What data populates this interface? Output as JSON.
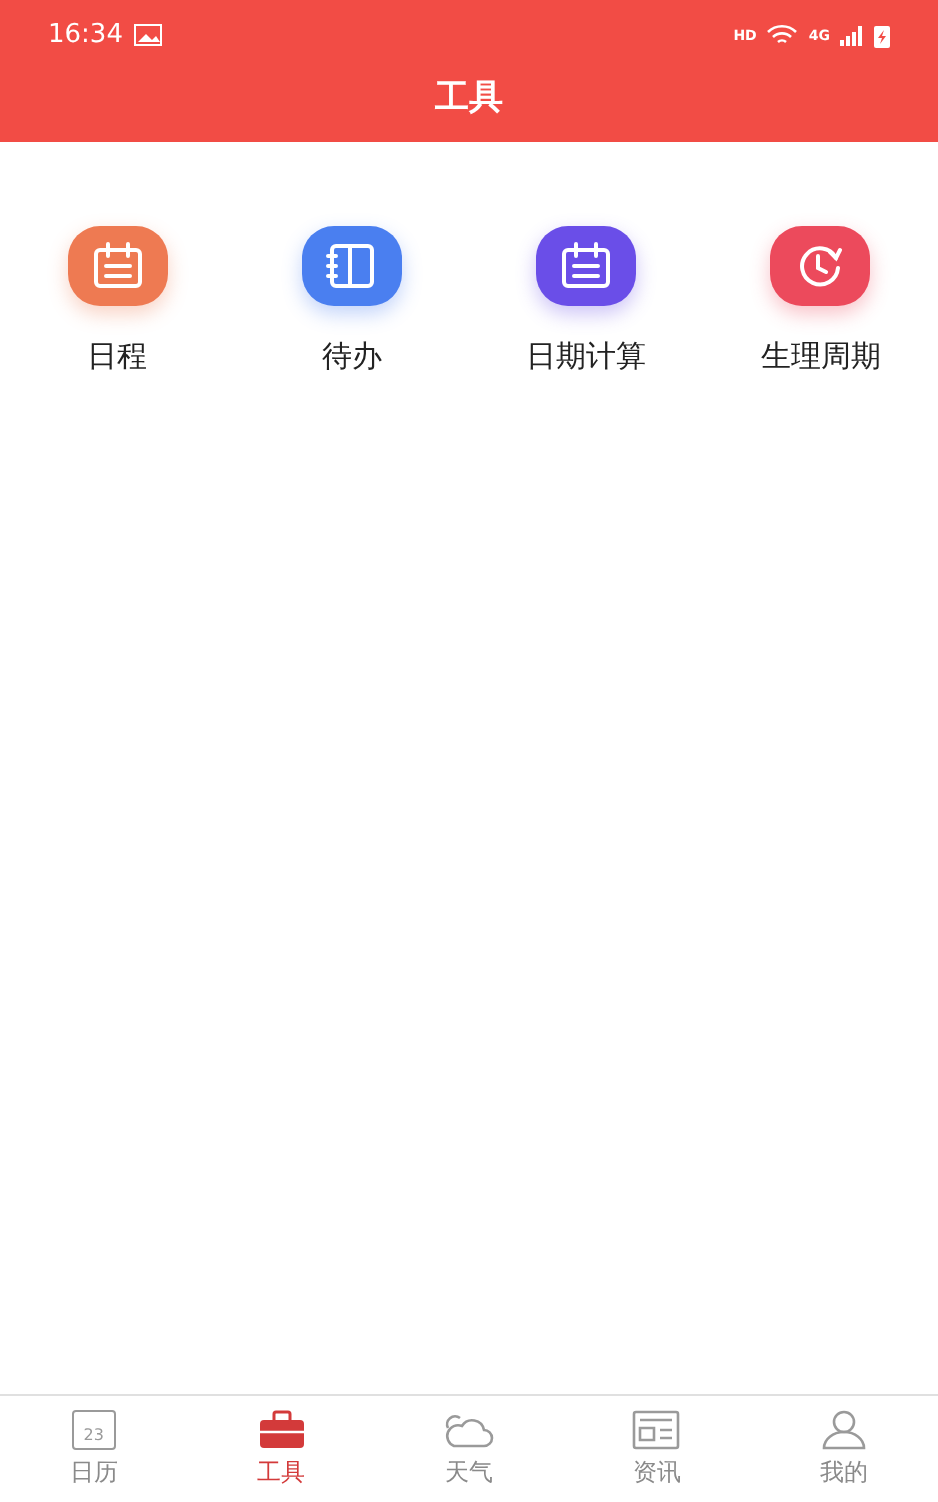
{
  "status_bar": {
    "time": "16:34",
    "network_label": "HD",
    "cell_label": "4G"
  },
  "header": {
    "title": "工具"
  },
  "tools": [
    {
      "label": "日程",
      "kind": "calendar",
      "color": "#ee7a52"
    },
    {
      "label": "待办",
      "kind": "notebook",
      "color": "#4a7ff0"
    },
    {
      "label": "日期计算",
      "kind": "calendar",
      "color": "#6a4ee8"
    },
    {
      "label": "生理周期",
      "kind": "clock",
      "color": "#ec4a5c"
    }
  ],
  "tab_bar": [
    {
      "label": "日历",
      "kind": "calendar",
      "icon_text": "23",
      "selected": false
    },
    {
      "label": "工具",
      "kind": "toolbox",
      "selected": true
    },
    {
      "label": "天气",
      "kind": "weather",
      "selected": false
    },
    {
      "label": "资讯",
      "kind": "news",
      "selected": false
    },
    {
      "label": "我的",
      "kind": "person",
      "selected": false
    }
  ]
}
